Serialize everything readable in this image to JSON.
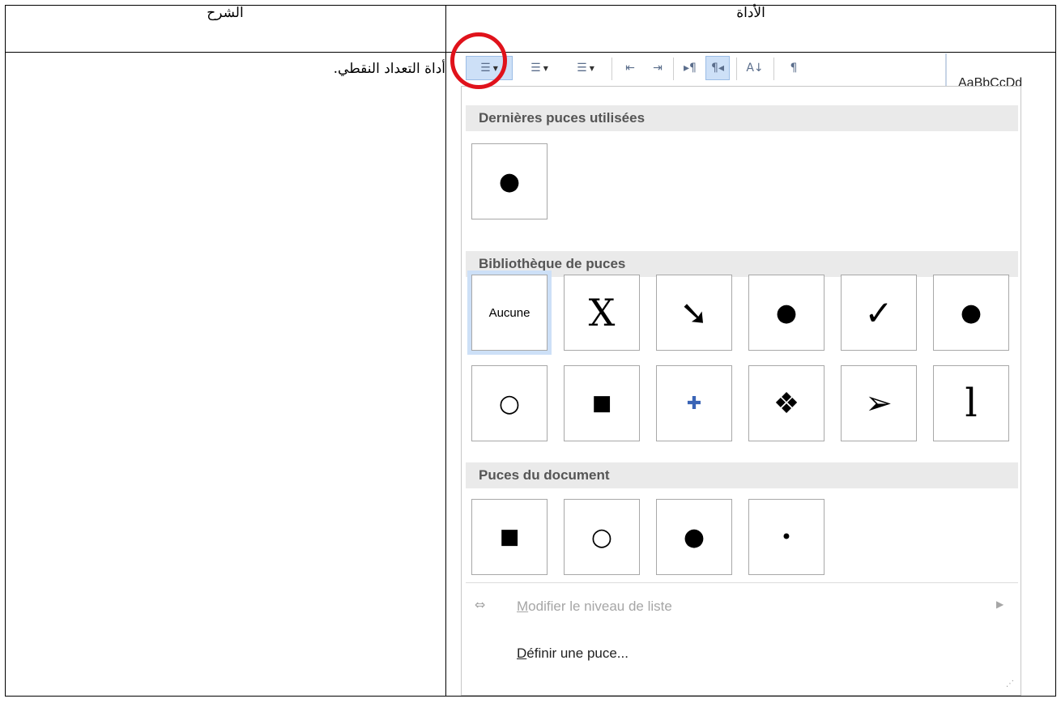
{
  "table": {
    "header_right": "الأداة",
    "header_left": "الشرح",
    "row_label": "أداة التعداد النقطي."
  },
  "ribbon": {
    "styles_preview": "AaBbCcDd"
  },
  "dropdown": {
    "recent_title": "Dernières puces utilisées",
    "library_title": "Bibliothèque de puces",
    "document_title": "Puces du document",
    "recent_bullets": [
      "●"
    ],
    "library_bullets": [
      "Aucune",
      "X",
      "➘",
      "●",
      "✓",
      "●",
      "○",
      "■",
      "✚",
      "❖",
      "➢",
      "l"
    ],
    "document_bullets": [
      "■",
      "○",
      "●",
      "•"
    ],
    "change_level_pre": "",
    "change_level_u": "M",
    "change_level_post": "odifier le niveau de liste",
    "define_u": "D",
    "define_post": "éfinir une puce..."
  },
  "colors": {
    "highlight_circle": "#e0121b",
    "selection": "#cde0f7"
  }
}
